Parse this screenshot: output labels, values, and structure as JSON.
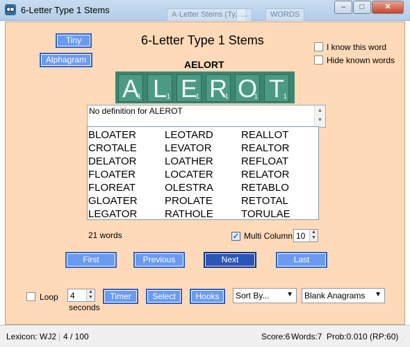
{
  "window": {
    "title": "6-Letter Type 1 Stems",
    "bg_tabs": [
      "A-Letter Stems (Ty...",
      "...",
      "WORDS"
    ],
    "minimize": "–",
    "maximize": "□",
    "close": "✕"
  },
  "controls": {
    "tiny_label": "Tiny",
    "alphagram_label": "Alphagram",
    "i_know_label": "I know this word",
    "hide_known_label": "Hide known words"
  },
  "quiz": {
    "title": "6-Letter Type 1 Stems",
    "alphagram": "AELORT",
    "tiles": [
      {
        "letter": "A",
        "points": "1"
      },
      {
        "letter": "L",
        "points": "1"
      },
      {
        "letter": "E",
        "points": "1"
      },
      {
        "letter": "R",
        "points": "1"
      },
      {
        "letter": "O",
        "points": "1"
      },
      {
        "letter": "T",
        "points": "1"
      }
    ],
    "definition": "No definition for ALEROT"
  },
  "words": {
    "col1": [
      "BLOATER",
      "CROTALE",
      "DELATOR",
      "FLOATER",
      "FLOREAT",
      "GLOATER",
      "LEGATOR"
    ],
    "col2": [
      "LEOTARD",
      "LEVATOR",
      "LOATHER",
      "LOCATER",
      "OLESTRA",
      "PROLATE",
      "RATHOLE"
    ],
    "col3": [
      "REALLOT",
      "REALTOR",
      "REFLOAT",
      "RELATOR",
      "RETABLO",
      "RETOTAL",
      "TORULAE"
    ],
    "count_text": "21 words",
    "multi_column_label": "Multi Column",
    "multi_column_checked": true,
    "columns_value": "10"
  },
  "nav": {
    "first": "First",
    "previous": "Previous",
    "next": "Next",
    "last": "Last"
  },
  "bottom": {
    "loop_label": "Loop",
    "seconds_value": "4",
    "seconds_label": "seconds",
    "timer": "Timer",
    "select": "Select",
    "hooks": "Hooks",
    "sort_by": "Sort By...",
    "blank_anagrams": "Blank Anagrams"
  },
  "status": {
    "lexicon": "Lexicon: WJ2",
    "progress": "4 / 100",
    "score": "Score:6",
    "words": "Words:7",
    "prob": "Prob:0.010 (RP:60)"
  },
  "colors": {
    "panel_bg": "#ffdab9",
    "button": "#6a9bf0",
    "button_active": "#2b56b8",
    "tile": "#4c9a83"
  }
}
